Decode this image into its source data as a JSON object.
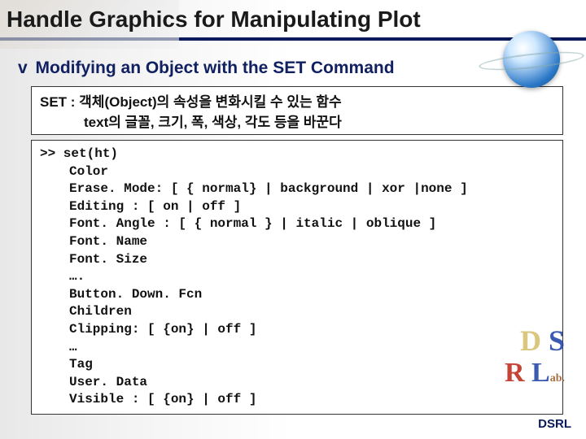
{
  "title": "Handle Graphics for Manipulating Plot",
  "subtitle_prefix": "v",
  "subtitle": "Modifying an Object with the SET Command",
  "desc": {
    "line1": "SET : 객체(Object)의 속성을 변화시킬 수 있는 함수",
    "line2": "text의 글꼴, 크기, 폭, 색상, 각도 등을 바꾼다"
  },
  "code": {
    "prompt": ">> set(ht)",
    "lines": [
      "Color",
      "Erase. Mode: [ { normal} | background | xor |none ]",
      "Editing : [ on | off ]",
      "Font. Angle : [ { normal } | italic | oblique ]",
      "Font. Name",
      "Font. Size",
      "….",
      "Button. Down. Fcn",
      "Children",
      "Clipping: [ {on} | off ]",
      "…",
      "Tag",
      "User. Data",
      "Visible : [ {on} | off ]"
    ]
  },
  "watermark": {
    "row1_left": "D",
    "row1_right": "S",
    "row2_left": "R",
    "row2_mid": "L",
    "row2_suffix": "ab."
  },
  "footer": "DSRL"
}
